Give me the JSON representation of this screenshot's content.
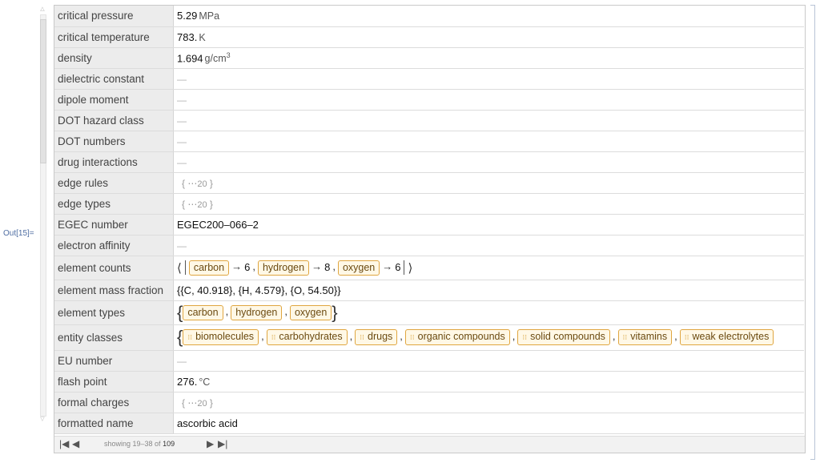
{
  "out_label": "Out[15]=",
  "rows": [
    {
      "key": "critical pressure",
      "kind": "quantity",
      "num": "5.29",
      "unit": "MPa"
    },
    {
      "key": "critical temperature",
      "kind": "quantity",
      "num": "783.",
      "unit": "K"
    },
    {
      "key": "density",
      "kind": "quantity",
      "num": "1.694",
      "unit": "g/cm",
      "sup": "3"
    },
    {
      "key": "dielectric constant",
      "kind": "missing",
      "text": "—"
    },
    {
      "key": "dipole moment",
      "kind": "missing",
      "text": "—"
    },
    {
      "key": "DOT hazard class",
      "kind": "missing",
      "text": "—"
    },
    {
      "key": "DOT numbers",
      "kind": "missing",
      "text": "—"
    },
    {
      "key": "drug interactions",
      "kind": "missing",
      "text": "—"
    },
    {
      "key": "edge rules",
      "kind": "skeleton",
      "count": "20"
    },
    {
      "key": "edge types",
      "kind": "skeleton",
      "count": "20"
    },
    {
      "key": "EGEC number",
      "kind": "text",
      "text": "EGEC200–066–2"
    },
    {
      "key": "electron affinity",
      "kind": "missing",
      "text": "—"
    },
    {
      "key": "element counts",
      "kind": "association",
      "items": [
        {
          "entity": "carbon",
          "value": "6"
        },
        {
          "entity": "hydrogen",
          "value": "8"
        },
        {
          "entity": "oxygen",
          "value": "6"
        }
      ]
    },
    {
      "key": "element mass fraction",
      "kind": "text",
      "text": "{{C, 40.918}, {H, 4.579}, {O, 54.50}}"
    },
    {
      "key": "element types",
      "kind": "entities",
      "items": [
        "carbon",
        "hydrogen",
        "oxygen"
      ]
    },
    {
      "key": "entity classes",
      "kind": "entities",
      "grid": true,
      "items": [
        "biomolecules",
        "carbohydrates",
        "drugs",
        "organic compounds",
        "solid compounds",
        "vitamins",
        "weak electrolytes"
      ]
    },
    {
      "key": "EU number",
      "kind": "missing",
      "text": "—"
    },
    {
      "key": "flash point",
      "kind": "quantity",
      "num": "276.",
      "unit": "°C"
    },
    {
      "key": "formal charges",
      "kind": "skeleton",
      "count": "20"
    },
    {
      "key": "formatted name",
      "kind": "text",
      "text": "ascorbic acid"
    }
  ],
  "footer": {
    "first_icon": "first-page-icon",
    "prev_icon": "previous-page-icon",
    "next_icon": "next-page-icon",
    "last_icon": "last-page-icon",
    "showing_prefix": "showing 19–38 of",
    "total": "109"
  }
}
